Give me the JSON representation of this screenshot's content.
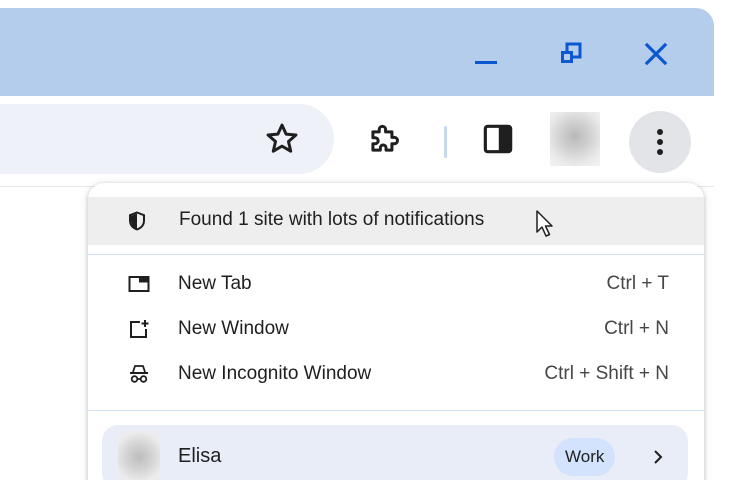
{
  "window": {
    "minimize_icon": "minimize-icon",
    "maximize_icon": "restore-icon",
    "close_icon": "close-icon",
    "accent_color": "#0b57d0",
    "titlebar_color": "#b5cdec"
  },
  "toolbar": {
    "bookmark_icon": "star-icon",
    "extensions_icon": "puzzle-icon",
    "side_panel_icon": "side-panel-icon",
    "profile_avatar": "avatar",
    "menu_icon": "three-dot-menu-icon"
  },
  "menu": {
    "alert": {
      "icon": "shield-icon",
      "label": "Found 1 site with lots of notifications"
    },
    "items": [
      {
        "icon": "new-tab-icon",
        "label": "New Tab",
        "shortcut": "Ctrl + T"
      },
      {
        "icon": "new-window-icon",
        "label": "New Window",
        "shortcut": "Ctrl + N"
      },
      {
        "icon": "incognito-icon",
        "label": "New Incognito Window",
        "shortcut": "Ctrl + Shift + N"
      }
    ],
    "profile": {
      "name": "Elisa",
      "badge": "Work",
      "chevron_icon": "chevron-right-icon"
    }
  }
}
